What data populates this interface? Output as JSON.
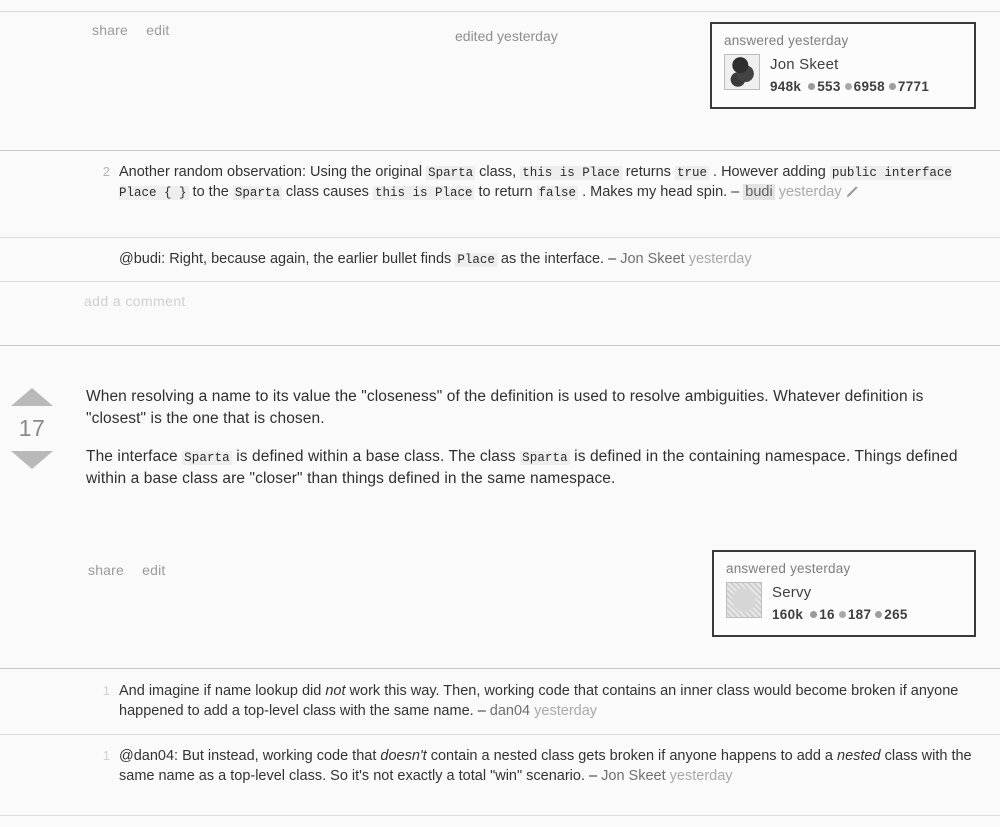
{
  "theme": {
    "page_bg": "#fdfdfd",
    "text": "#2f2f2f",
    "muted": "#9b9b9b",
    "code_bg": "#eeeeee",
    "card_border": "#3a3a3a",
    "arrow": "#b9b9b9"
  },
  "answer_top": {
    "actions": {
      "share_label": "share",
      "edit_label": "edit"
    },
    "edited_note": "edited yesterday",
    "user_card": {
      "time_label": "answered yesterday",
      "username": "Jon Skeet",
      "reputation": "948k",
      "gold_badges": "553",
      "silver_badges": "6958",
      "bronze_badges": "7771",
      "avatar_name": "jon-skeet-avatar"
    },
    "comments": [
      {
        "score": "2",
        "parts": [
          {
            "t": "text",
            "v": "Another random observation: Using the original "
          },
          {
            "t": "code",
            "v": "Sparta"
          },
          {
            "t": "text",
            "v": " class, "
          },
          {
            "t": "code",
            "v": "this is Place"
          },
          {
            "t": "text",
            "v": " returns "
          },
          {
            "t": "code",
            "v": "true"
          },
          {
            "t": "text",
            "v": ". However adding "
          },
          {
            "t": "code",
            "v": "public interface Place { }"
          },
          {
            "t": "text",
            "v": " to the "
          },
          {
            "t": "code",
            "v": "Sparta"
          },
          {
            "t": "text",
            "v": " class causes "
          },
          {
            "t": "code",
            "v": "this is Place"
          },
          {
            "t": "text",
            "v": " to return "
          },
          {
            "t": "code",
            "v": "false"
          },
          {
            "t": "text",
            "v": ". Makes my head spin. – "
          },
          {
            "t": "highlight-user",
            "v": "budi"
          },
          {
            "t": "date",
            "v": "yesterday"
          },
          {
            "t": "pencil",
            "v": "edit-pencil-icon"
          }
        ]
      },
      {
        "score": "",
        "parts": [
          {
            "t": "text",
            "v": "@budi: Right, because again, the earlier bullet finds "
          },
          {
            "t": "code",
            "v": "Place"
          },
          {
            "t": "text",
            "v": " as the interface. – "
          },
          {
            "t": "user",
            "v": "Jon Skeet"
          },
          {
            "t": "date",
            "v": "yesterday"
          }
        ]
      }
    ],
    "add_comment_label": "add a comment"
  },
  "answer_second": {
    "vote": {
      "score": "17",
      "up_icon": "vote-up-arrow-icon",
      "down_icon": "vote-down-arrow-icon"
    },
    "paragraphs": [
      [
        {
          "t": "text",
          "v": "When resolving a name to its value the \"closeness\" of the definition is used to resolve ambiguities. Whatever definition is \"closest\" is the one that is chosen."
        }
      ],
      [
        {
          "t": "text",
          "v": "The interface "
        },
        {
          "t": "code",
          "v": "Sparta"
        },
        {
          "t": "text",
          "v": " is defined within a base class. The class "
        },
        {
          "t": "code",
          "v": "Sparta"
        },
        {
          "t": "text",
          "v": " is defined in the containing namespace. Things defined within a base class are \"closer\" than things defined in the same namespace."
        }
      ]
    ],
    "actions": {
      "share_label": "share",
      "edit_label": "edit"
    },
    "user_card": {
      "time_label": "answered yesterday",
      "username": "Servy",
      "reputation": "160k",
      "gold_badges": "16",
      "silver_badges": "187",
      "bronze_badges": "265",
      "avatar_name": "servy-avatar"
    },
    "comments": [
      {
        "score": "1",
        "parts": [
          {
            "t": "text",
            "v": "And imagine if name lookup did "
          },
          {
            "t": "italic",
            "v": "not"
          },
          {
            "t": "text",
            "v": " work this way. Then, working code that contains an inner class would become broken if anyone happened to add a top-level class with the same name. – "
          },
          {
            "t": "user",
            "v": "dan04"
          },
          {
            "t": "date",
            "v": "yesterday"
          }
        ]
      },
      {
        "score": "1",
        "parts": [
          {
            "t": "text",
            "v": "@dan04: But instead, working code that "
          },
          {
            "t": "italic",
            "v": "doesn't"
          },
          {
            "t": "text",
            "v": " contain a nested class gets broken if anyone happens to add a "
          },
          {
            "t": "italic",
            "v": "nested"
          },
          {
            "t": "text",
            "v": " class with the same name as a top-level class. So it's not exactly a total \"win\" scenario. – "
          },
          {
            "t": "user",
            "v": "Jon Skeet"
          },
          {
            "t": "date",
            "v": "yesterday"
          }
        ]
      }
    ]
  }
}
